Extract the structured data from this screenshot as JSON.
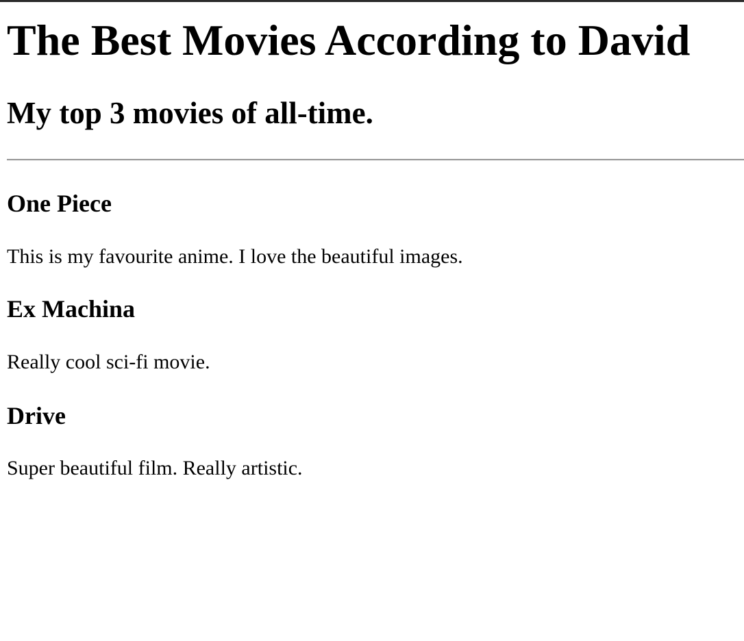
{
  "page": {
    "title": "The Best Movies According to David",
    "subtitle": "My top 3 movies of all-time."
  },
  "movies": [
    {
      "title": "One Piece",
      "description": "This is my favourite anime. I love the beautiful images."
    },
    {
      "title": "Ex Machina",
      "description": "Really cool sci-fi movie."
    },
    {
      "title": "Drive",
      "description": "Super beautiful film. Really artistic."
    }
  ]
}
